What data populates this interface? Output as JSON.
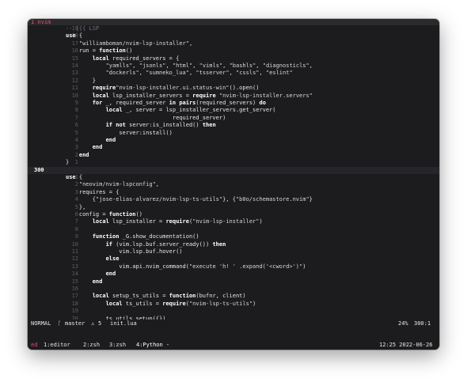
{
  "tabline": {
    "label": "1 nvim"
  },
  "editor": {
    "lines": [
      {
        "n": "19",
        "t": "-- {{{ LSP",
        "c": "cm"
      },
      {
        "n": "18",
        "t": "use {",
        "c": "kw"
      },
      {
        "n": "17",
        "t": "    \"williamboman/nvim-lsp-installer\","
      },
      {
        "n": "16",
        "t": "    run = function()"
      },
      {
        "n": "15",
        "t": "        local required_servers = {"
      },
      {
        "n": "14",
        "t": "            \"yamlls\", \"jsonls\", \"html\", \"vimls\", \"bashls\", \"diagnosticls\","
      },
      {
        "n": "13",
        "t": "            \"dockerls\", \"sumneko_lua\", \"tsserver\", \"cssls\", \"eslint\""
      },
      {
        "n": "12",
        "t": "        }"
      },
      {
        "n": "11",
        "t": "        require\"nvim-lsp-installer.ui.status-win\"().open()"
      },
      {
        "n": "10",
        "t": "        local lsp_installer_servers = require \"nvim-lsp-installer.servers\""
      },
      {
        "n": "9",
        "t": "        for _, required_server in pairs(required_servers) do"
      },
      {
        "n": "8",
        "t": "            local _, server = lsp_installer_servers.get_server("
      },
      {
        "n": "7",
        "t": "                                required_server)"
      },
      {
        "n": "6",
        "t": "            if not server:is_installed() then"
      },
      {
        "n": "5",
        "t": "                server:install()"
      },
      {
        "n": "4",
        "t": "            end"
      },
      {
        "n": "3",
        "t": "        end"
      },
      {
        "n": "2",
        "t": "    end"
      },
      {
        "n": "1",
        "t": "}"
      },
      {
        "n": "300",
        "t": "",
        "cursor": true
      },
      {
        "n": "1",
        "t": "use {"
      },
      {
        "n": "2",
        "t": "    \"neovim/nvim-lspconfig\","
      },
      {
        "n": "3",
        "t": "    requires = {"
      },
      {
        "n": "4",
        "t": "        {\"jose-elias-alvarez/nvim-lsp-ts-utils\"}, {\"b0o/schemastore.nvim\"}"
      },
      {
        "n": "5",
        "t": "    },"
      },
      {
        "n": "6",
        "t": "    config = function()"
      },
      {
        "n": "7",
        "t": "        local lsp_installer = require(\"nvim-lsp-installer\")"
      },
      {
        "n": "8",
        "t": ""
      },
      {
        "n": "9",
        "t": "        function _G.show_documentation()"
      },
      {
        "n": "10",
        "t": "            if (vim.lsp.buf.server_ready()) then"
      },
      {
        "n": "11",
        "t": "                vim.lsp.buf.hover()"
      },
      {
        "n": "12",
        "t": "            else"
      },
      {
        "n": "13",
        "t": "                vim.api.nvim_command(\"execute 'h! ' .expand('<cword>')\")"
      },
      {
        "n": "14",
        "t": "            end"
      },
      {
        "n": "15",
        "t": "        end"
      },
      {
        "n": "16",
        "t": ""
      },
      {
        "n": "17",
        "t": "        local setup_ts_utils = function(bufnr, client)"
      },
      {
        "n": "18",
        "t": "            local ts_utils = require(\"nvim-lsp-ts-utils\")"
      },
      {
        "n": "19",
        "t": ""
      },
      {
        "n": "20",
        "t": "            ts_utils.setup({})"
      }
    ]
  },
  "statusline": {
    "mode": "NORMAL",
    "branch_icon": "git-branch-icon",
    "branch": "master",
    "warn_icon": "warning-triangle-icon",
    "warnings": "5",
    "file": "init.lua",
    "percent": "24%",
    "position": "300:1"
  },
  "tmux": {
    "session": "ed",
    "windows": [
      {
        "label": "1:editor"
      },
      {
        "label": "2:zsh"
      },
      {
        "label": "3:zsh"
      },
      {
        "label": "4:Python -"
      }
    ],
    "clock": "12:25 2022-06-26"
  }
}
